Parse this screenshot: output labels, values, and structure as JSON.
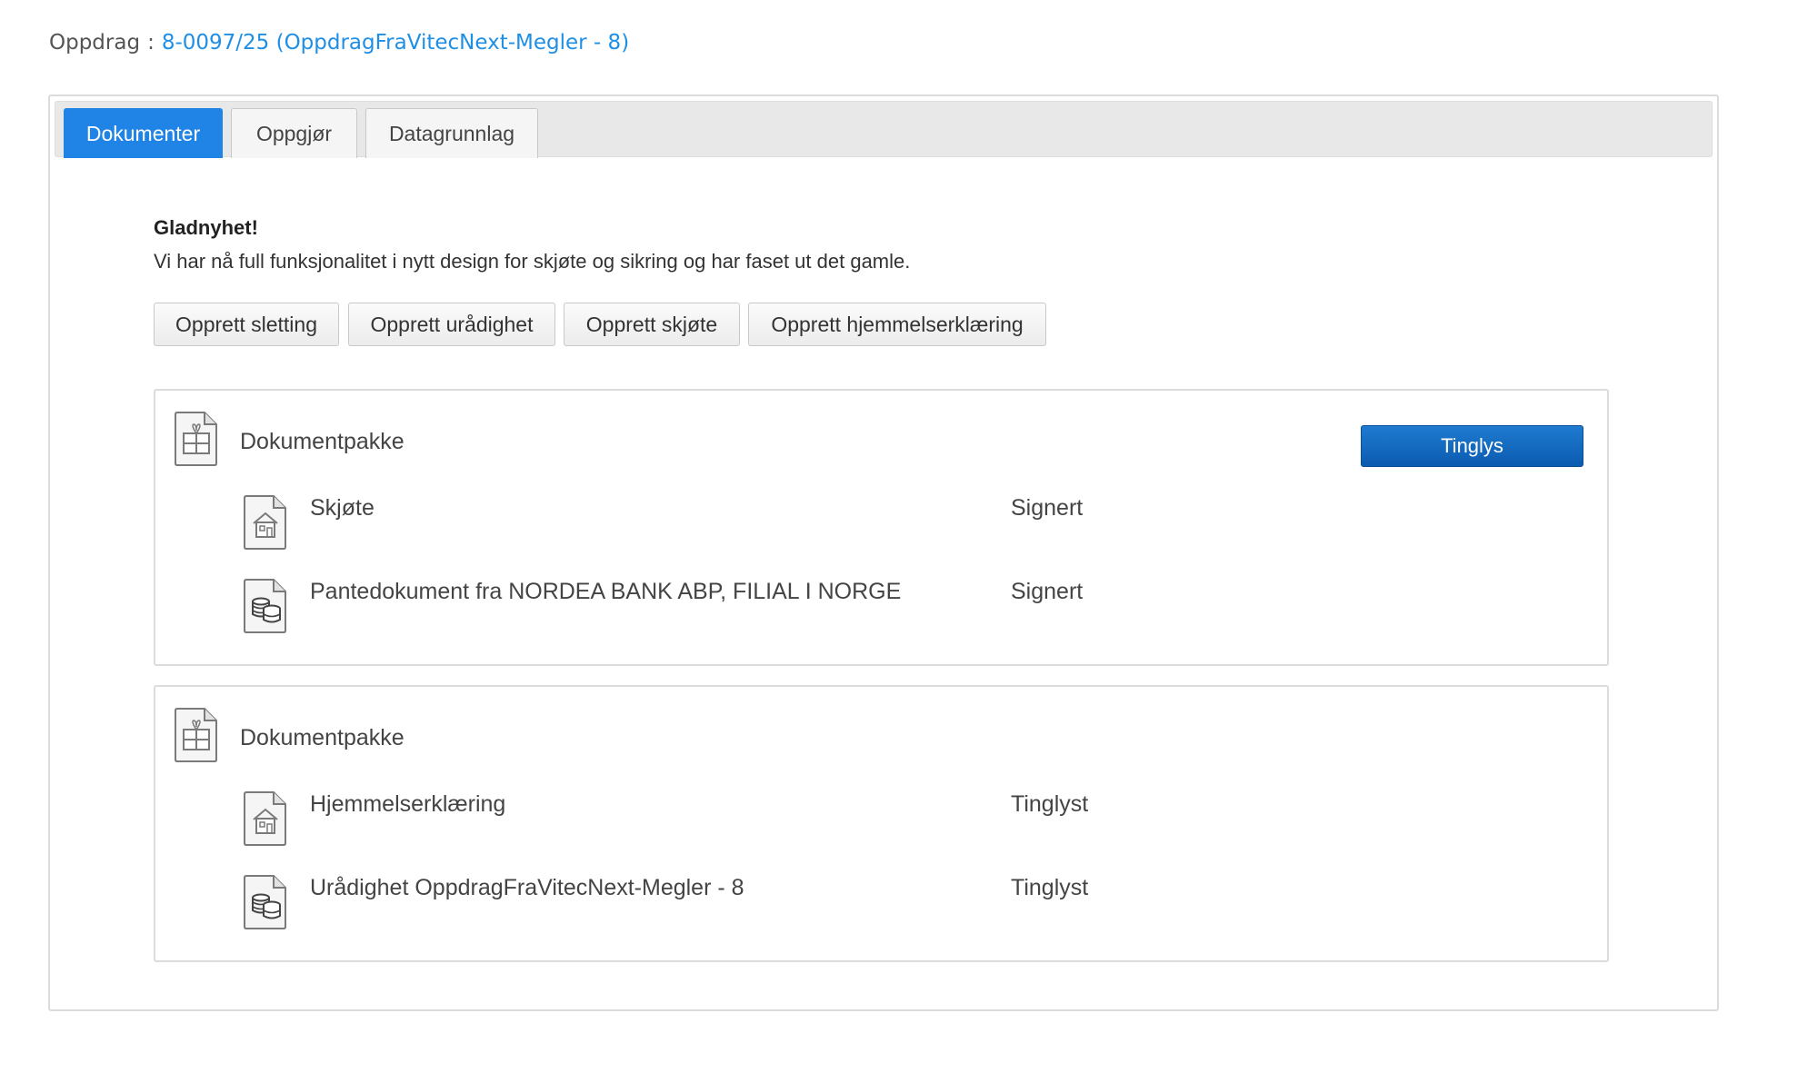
{
  "header": {
    "label": "Oppdrag",
    "separator": ":",
    "link_text": "8-0097/25 (OppdragFraVitecNext-Megler - 8)"
  },
  "tabs": [
    {
      "label": "Dokumenter",
      "active": true
    },
    {
      "label": "Oppgjør",
      "active": false
    },
    {
      "label": "Datagrunnlag",
      "active": false
    }
  ],
  "notice": {
    "title": "Gladnyhet!",
    "text": "Vi har nå full funksjonalitet i nytt design for skjøte og sikring og har faset ut det gamle."
  },
  "actions": [
    {
      "label": "Opprett sletting"
    },
    {
      "label": "Opprett urådighet"
    },
    {
      "label": "Opprett skjøte"
    },
    {
      "label": "Opprett hjemmelserklæring"
    }
  ],
  "packages": [
    {
      "title": "Dokumentpakke",
      "button_label": "Tinglys",
      "documents": [
        {
          "name": "Skjøte",
          "status": "Signert",
          "icon": "house-document-icon"
        },
        {
          "name": "Pantedokument fra NORDEA BANK ABP, FILIAL I NORGE",
          "status": "Signert",
          "icon": "coins-document-icon"
        }
      ]
    },
    {
      "title": "Dokumentpakke",
      "documents": [
        {
          "name": "Hjemmelserklæring",
          "status": "Tinglyst",
          "icon": "house-document-icon"
        },
        {
          "name": "Urådighet OppdragFraVitecNext-Megler - 8",
          "status": "Tinglyst",
          "icon": "coins-document-icon"
        }
      ]
    }
  ],
  "colors": {
    "accent": "#1f84e6",
    "link": "#1f8fe5",
    "primary_button": "#0b5bb0",
    "border": "#dcdcdc"
  }
}
